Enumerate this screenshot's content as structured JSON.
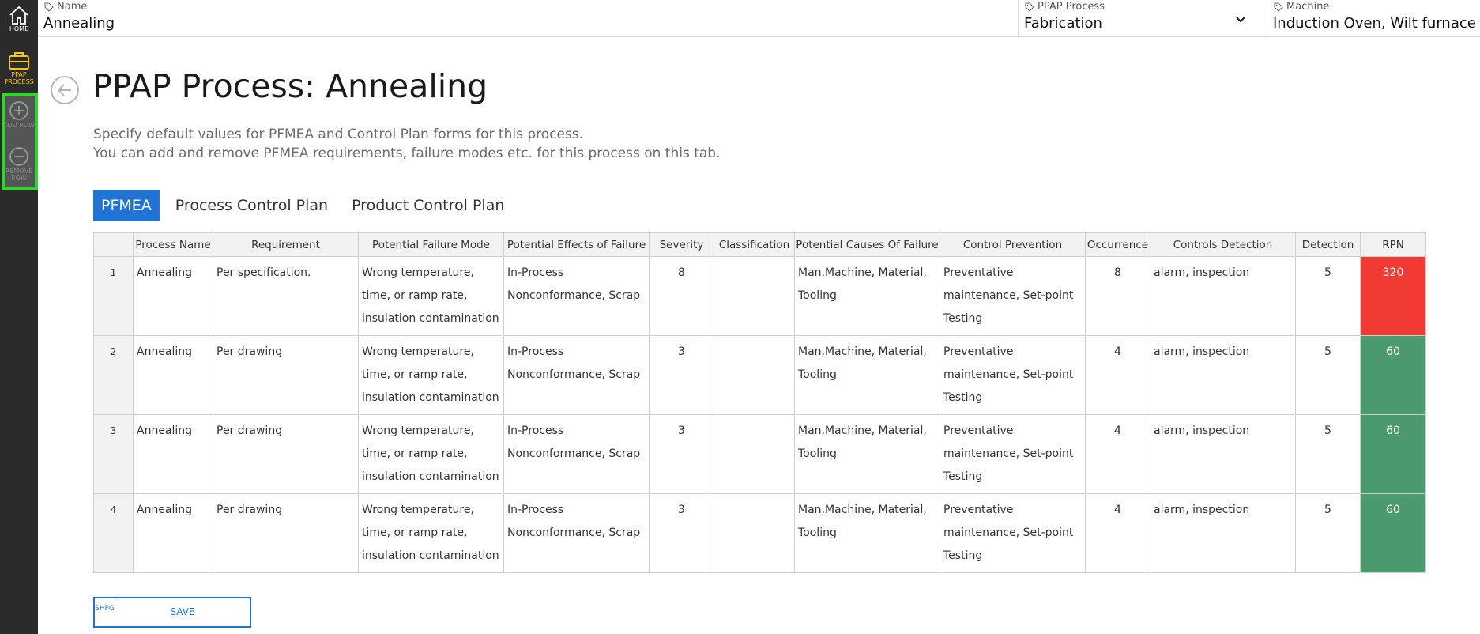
{
  "sidebar": {
    "home_label": "HOME",
    "ppap_label": "PPAP PROCESS",
    "add_row_label": "ADD ROW",
    "remove_row_label": "REMOVE ROW"
  },
  "header": {
    "name_label": "Name",
    "name_value": "Annealing",
    "process_label": "PPAP Process",
    "process_value": "Fabrication",
    "machine_label": "Machine",
    "machine_value": "Induction Oven, Wilt furnace"
  },
  "page": {
    "title": "PPAP Process: Annealing",
    "desc_line1": "Specify default values for PFMEA and Control Plan forms for this process.",
    "desc_line2": "You can add and remove PFMEA requirements, failure modes etc. for this process on this tab."
  },
  "tabs": [
    "PFMEA",
    "Process Control Plan",
    "Product Control Plan"
  ],
  "table": {
    "columns": [
      "",
      "Process Name",
      "Requirement",
      "Potential Failure Mode",
      "Potential Effects of Failure",
      "Severity",
      "Classification",
      "Potential Causes Of Failure",
      "Control Prevention",
      "Occurrence",
      "Controls Detection",
      "Detection",
      "RPN"
    ],
    "rows": [
      {
        "idx": "1",
        "process": "Annealing",
        "requirement": "Per specification.",
        "failure_mode": "Wrong temperature, time, or ramp rate, insulation contamination",
        "effects": "In-Process Nonconformance, Scrap",
        "severity": "8",
        "classification": "",
        "causes": "Man,Machine, Material, Tooling",
        "prevention": "Preventative maintenance, Set-point Testing",
        "occurrence": "8",
        "detection_ctrl": "alarm, inspection",
        "detection": "5",
        "rpn": "320",
        "rpn_color": "#f23a35"
      },
      {
        "idx": "2",
        "process": "Annealing",
        "requirement": "Per drawing",
        "failure_mode": "Wrong temperature, time, or ramp rate, insulation contamination",
        "effects": "In-Process Nonconformance, Scrap",
        "severity": "3",
        "classification": "",
        "causes": "Man,Machine, Material, Tooling",
        "prevention": "Preventative maintenance, Set-point Testing",
        "occurrence": "4",
        "detection_ctrl": "alarm, inspection",
        "detection": "5",
        "rpn": "60",
        "rpn_color": "#4a9a6e"
      },
      {
        "idx": "3",
        "process": "Annealing",
        "requirement": "Per drawing",
        "failure_mode": "Wrong temperature, time, or ramp rate, insulation contamination",
        "effects": "In-Process Nonconformance, Scrap",
        "severity": "3",
        "classification": "",
        "causes": "Man,Machine, Material, Tooling",
        "prevention": "Preventative maintenance, Set-point Testing",
        "occurrence": "4",
        "detection_ctrl": "alarm, inspection",
        "detection": "5",
        "rpn": "60",
        "rpn_color": "#4a9a6e"
      },
      {
        "idx": "4",
        "process": "Annealing",
        "requirement": "Per drawing",
        "failure_mode": "Wrong temperature, time, or ramp rate, insulation contamination",
        "effects": "In-Process Nonconformance, Scrap",
        "severity": "3",
        "classification": "",
        "causes": "Man,Machine, Material, Tooling",
        "prevention": "Preventative maintenance, Set-point Testing",
        "occurrence": "4",
        "detection_ctrl": "alarm, inspection",
        "detection": "5",
        "rpn": "60",
        "rpn_color": "#4a9a6e"
      }
    ]
  },
  "save": {
    "shortcut": "SHFG",
    "label": "SAVE"
  },
  "icons": {
    "home": "home-icon",
    "ppap": "briefcase-icon",
    "add": "plus-circle-icon",
    "remove": "minus-circle-icon",
    "tag": "tag-icon",
    "back": "back-arrow-icon",
    "chevron": "chevron-down-icon"
  },
  "colors": {
    "accent": "#1f74d6",
    "sidebar": "#2b2b2b",
    "highlight": "#2ed62e",
    "ppap_active": "#f5c518"
  }
}
